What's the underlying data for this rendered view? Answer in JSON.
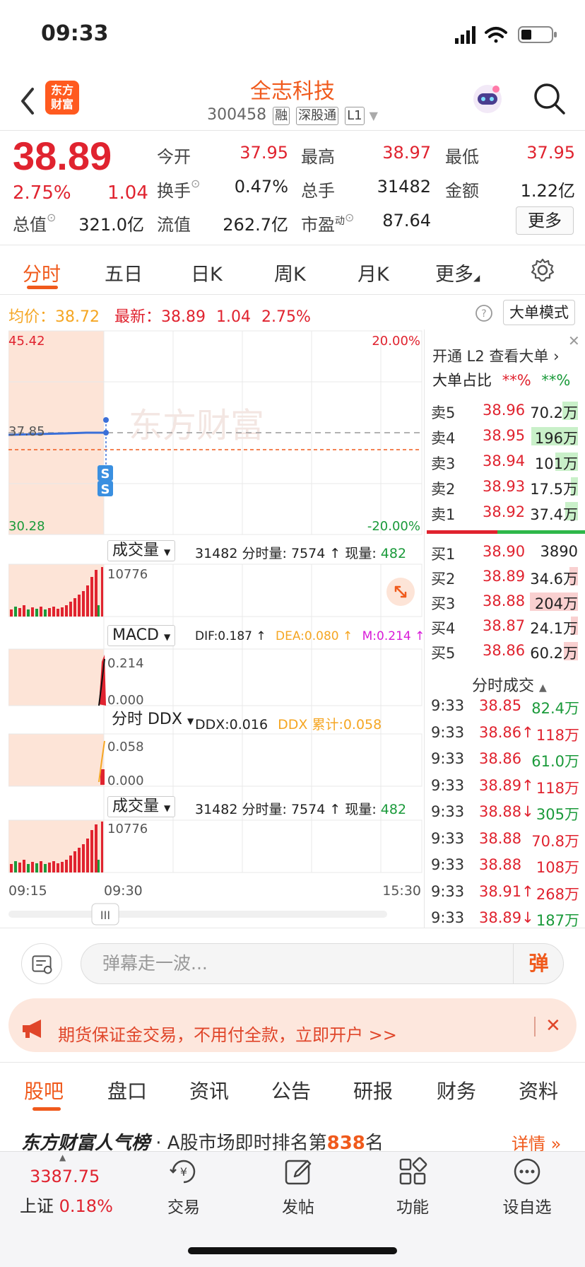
{
  "status": {
    "time": "09:33"
  },
  "header": {
    "logo_line1": "东方",
    "logo_line2": "财富",
    "name": "全志科技",
    "code": "300458",
    "tags": [
      "融",
      "深股通",
      "L1"
    ]
  },
  "quote": {
    "price": "38.89",
    "pct": "2.75%",
    "change": "1.04",
    "open_label": "今开",
    "open": "37.95",
    "high_label": "最高",
    "high": "38.97",
    "low_label": "最低",
    "low": "37.95",
    "turnover_label": "换手",
    "turnover": "0.47%",
    "volume_label": "总手",
    "volume": "31482",
    "amount_label": "金额",
    "amount": "1.22亿",
    "mcap_label": "总值",
    "mcap": "321.0亿",
    "float_label": "流值",
    "float": "262.7亿",
    "pe_label": "市盈",
    "pe_sup": "动",
    "pe": "87.64",
    "more": "更多"
  },
  "chart_tabs": [
    "分时",
    "五日",
    "日K",
    "周K",
    "月K",
    "更多"
  ],
  "info_line": {
    "avg_label": "均价：",
    "avg": "38.72",
    "last_label": "最新：",
    "last": "38.89",
    "change": "1.04",
    "pct": "2.75%",
    "mode_button": "大单模式"
  },
  "main_chart": {
    "y_top": "45.42",
    "y_bottom": "30.28",
    "pct_top": "20.00%",
    "pct_bottom": "-20.00%",
    "ref_label": "37.85",
    "watermark": "东方财富",
    "marker": "S"
  },
  "volume_panel": {
    "selector": "成交量",
    "total": "31482",
    "minute_label": "分时量:",
    "minute": "7574 ↑",
    "now_label": "现量:",
    "now": "482",
    "max": "10776"
  },
  "macd_panel": {
    "selector": "MACD",
    "dif": "DIF:0.187 ↑",
    "dea": "DEA:0.080 ↑",
    "m": "M:0.214 ↑",
    "top": "0.214",
    "bottom": "0.000"
  },
  "ddx_panel": {
    "selector": "分时 DDX",
    "ddx": "DDX:0.016",
    "ddx_cum": "DDX 累计:0.058",
    "top": "0.058",
    "bottom": "0.000"
  },
  "volume_panel2": {
    "selector": "成交量",
    "total": "31482",
    "minute_label": "分时量:",
    "minute": "7574 ↑",
    "now_label": "现量:",
    "now": "482",
    "max": "10776"
  },
  "time_axis": [
    "09:15",
    "09:30",
    "15:30"
  ],
  "slider_label": "III",
  "orderbook": {
    "l2_promo": "开通 L2 查看大单 ›",
    "bigorder_label": "大单占比",
    "bigorder_red": "**%",
    "bigorder_green": "**%",
    "asks": [
      {
        "label": "卖5",
        "price": "38.96",
        "vol": "70.2万"
      },
      {
        "label": "卖4",
        "price": "38.95",
        "vol": "196万"
      },
      {
        "label": "卖3",
        "price": "38.94",
        "vol": "101万"
      },
      {
        "label": "卖2",
        "price": "38.93",
        "vol": "17.5万"
      },
      {
        "label": "卖1",
        "price": "38.92",
        "vol": "37.4万"
      }
    ],
    "bids": [
      {
        "label": "买1",
        "price": "38.90",
        "vol": "3890"
      },
      {
        "label": "买2",
        "price": "38.89",
        "vol": "34.6万"
      },
      {
        "label": "买3",
        "price": "38.88",
        "vol": "204万"
      },
      {
        "label": "买4",
        "price": "38.87",
        "vol": "24.1万"
      },
      {
        "label": "买5",
        "price": "38.86",
        "vol": "60.2万"
      }
    ],
    "ticks_title": "分时成交",
    "ticks": [
      {
        "time": "9:33",
        "price": "38.85",
        "vol": "82.4万",
        "c": "green"
      },
      {
        "time": "9:33",
        "price": "38.86↑",
        "vol": "118万",
        "c": "red"
      },
      {
        "time": "9:33",
        "price": "38.86",
        "vol": "61.0万",
        "c": "green"
      },
      {
        "time": "9:33",
        "price": "38.89↑",
        "vol": "118万",
        "c": "red"
      },
      {
        "time": "9:33",
        "price": "38.88↓",
        "vol": "305万",
        "c": "green"
      },
      {
        "time": "9:33",
        "price": "38.88",
        "vol": "70.8万",
        "c": "red"
      },
      {
        "time": "9:33",
        "price": "38.88",
        "vol": "108万",
        "c": "red"
      },
      {
        "time": "9:33",
        "price": "38.91↑",
        "vol": "268万",
        "c": "red"
      },
      {
        "time": "9:33",
        "price": "38.89↓",
        "vol": "187万",
        "c": "green"
      }
    ]
  },
  "danmaku": {
    "placeholder": "弹幕走一波...",
    "button": "弹"
  },
  "ad": {
    "text": "期货保证金交易，不用付全款，立即开户 >>"
  },
  "bottom_tabs": [
    "股吧",
    "盘口",
    "资讯",
    "公告",
    "研报",
    "财务",
    "资料"
  ],
  "rank": {
    "title": "东方财富人气榜",
    "text": "· A股市场即时排名第",
    "rank": "838",
    "unit": "名",
    "detail": "详情"
  },
  "nav": {
    "index_value": "3387.75",
    "index_name": "上证",
    "index_pct": "0.18%",
    "trade": "交易",
    "post": "发帖",
    "functions": "功能",
    "watchlist": "设自选"
  }
}
